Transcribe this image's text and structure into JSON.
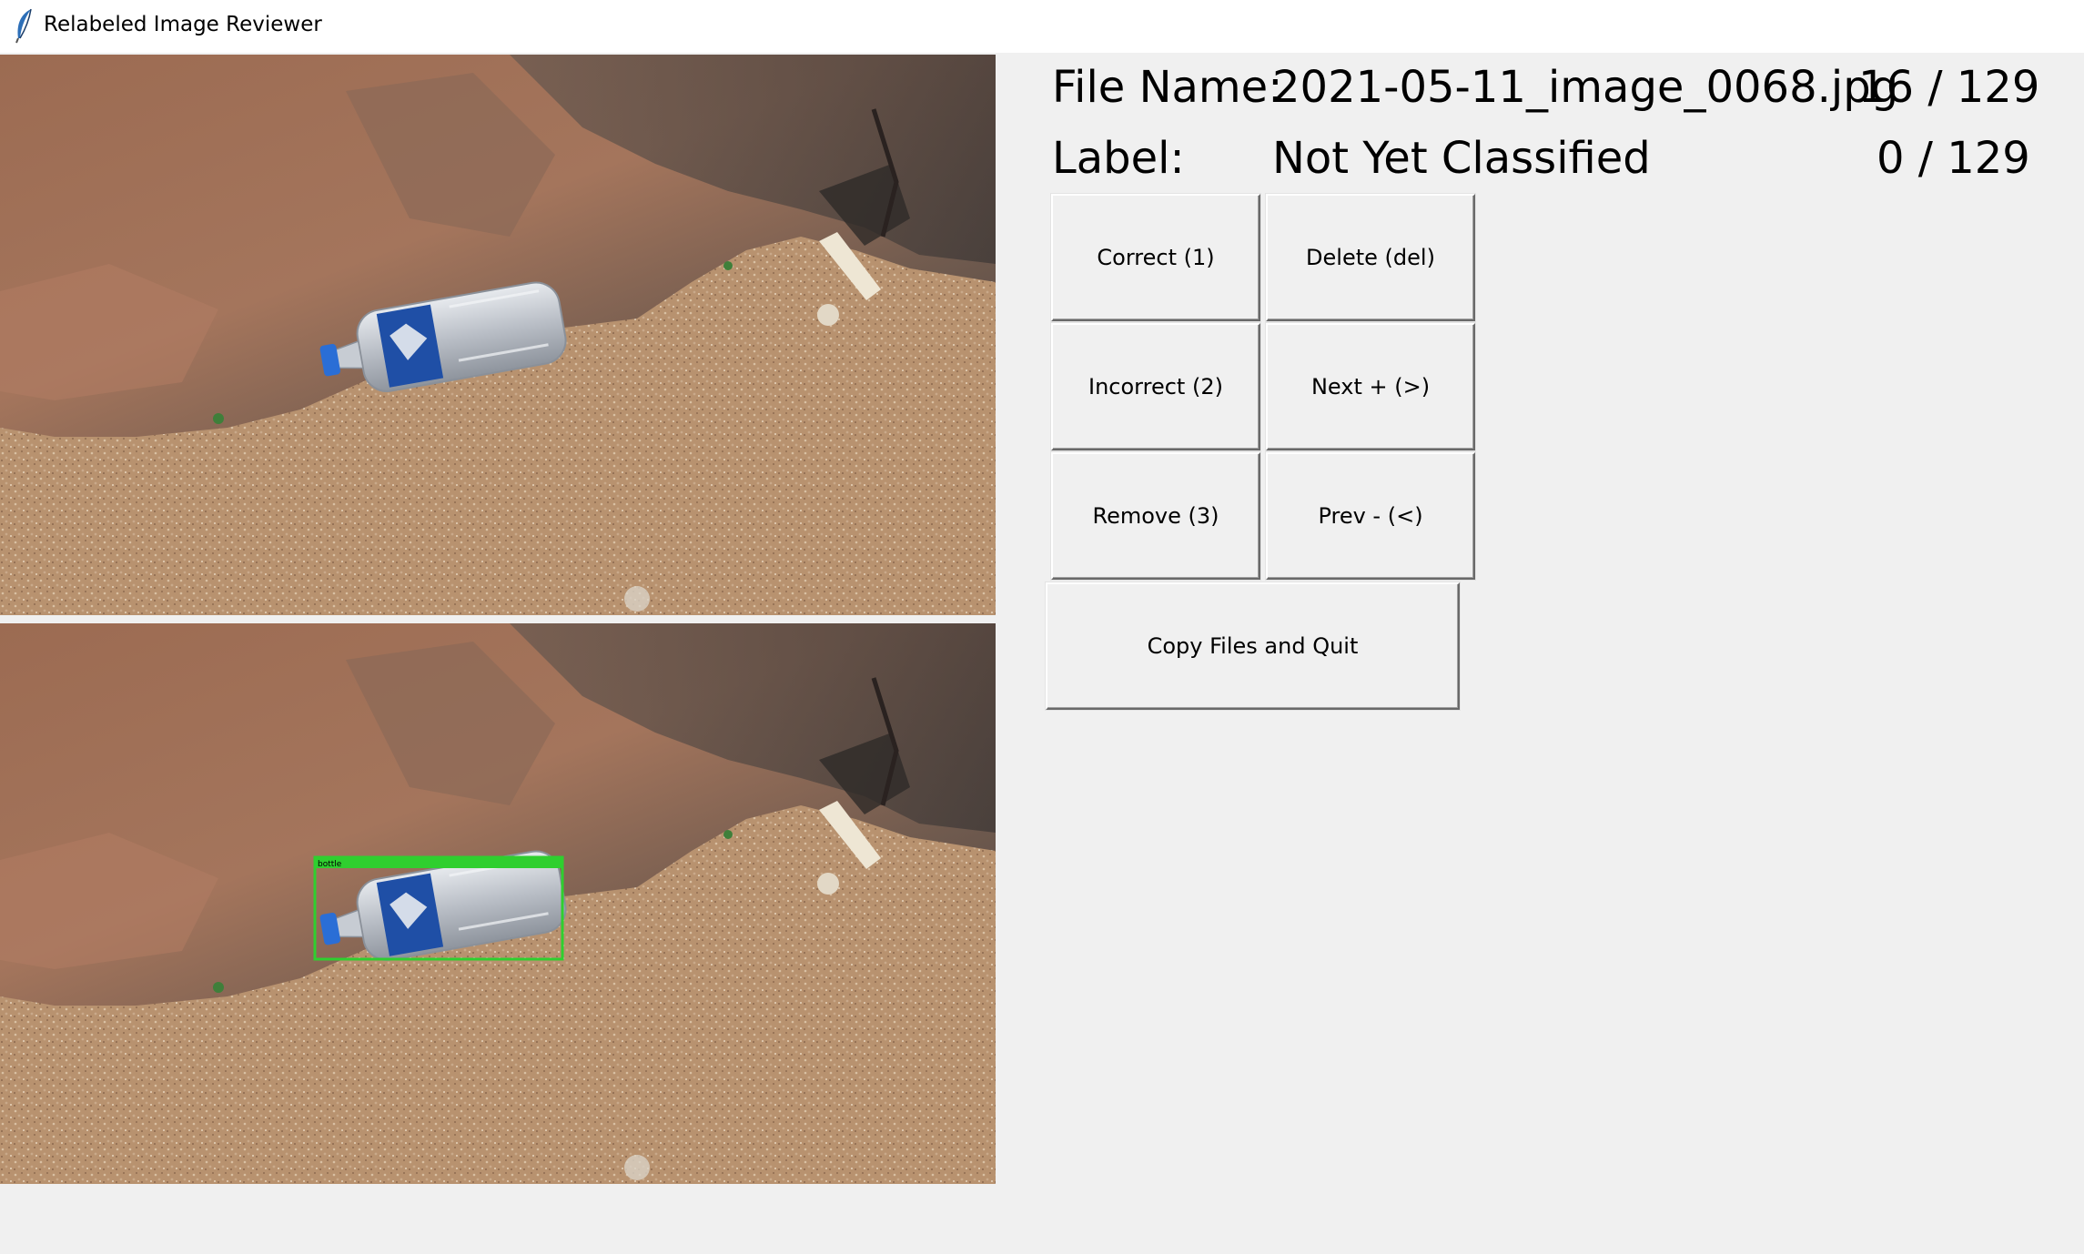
{
  "window": {
    "title": "Relabeled Image Reviewer",
    "icon": "feather-icon"
  },
  "info": {
    "file_name_label": "File Name:",
    "file_name": "2021-05-11_image_0068.jpg",
    "file_position": "16 / 129",
    "label_label": "Label:",
    "label_value": "Not Yet Classified",
    "classified_count": "0 / 129"
  },
  "annotation": {
    "class_name": "bottle",
    "box_color": "#2fcf2f"
  },
  "buttons": {
    "correct": "Correct (1)",
    "delete": "Delete (del)",
    "incorrect": "Incorrect (2)",
    "next": "Next + (>)",
    "remove": "Remove (3)",
    "prev": "Prev - (<)",
    "copy_quit": "Copy Files and Quit"
  }
}
